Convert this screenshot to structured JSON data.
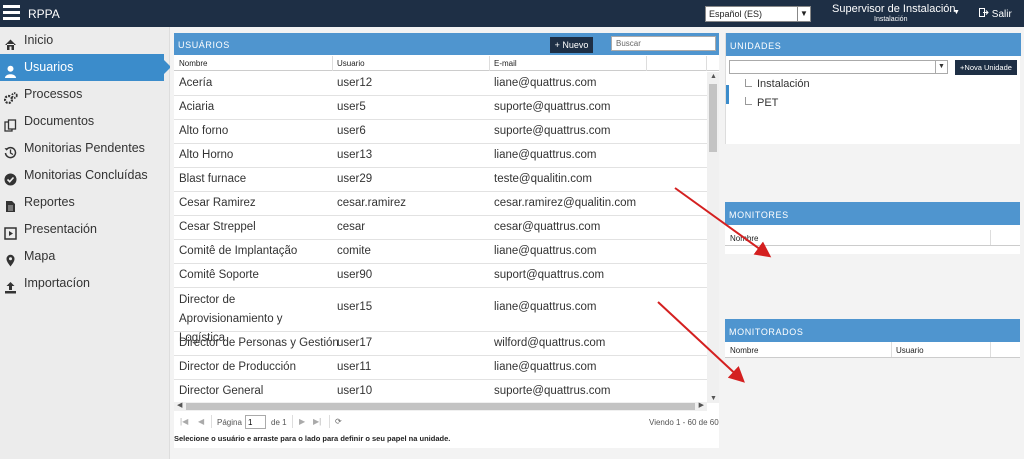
{
  "app": {
    "title": "RPPA"
  },
  "topbar": {
    "language": "Español (ES)",
    "user_name": "Supervisor de Instalación",
    "user_role": "Instalación",
    "logout_label": "Salir"
  },
  "sidebar": {
    "items": [
      {
        "label": "Inicio",
        "icon": "home-icon",
        "active": false
      },
      {
        "label": "Usuarios",
        "icon": "user-icon",
        "active": true
      },
      {
        "label": "Processos",
        "icon": "gears-icon",
        "active": false
      },
      {
        "label": "Documentos",
        "icon": "documents-icon",
        "active": false
      },
      {
        "label": "Monitorias Pendentes",
        "icon": "history-icon",
        "active": false
      },
      {
        "label": "Monitorias Concluídas",
        "icon": "check-circle-icon",
        "active": false
      },
      {
        "label": "Reportes",
        "icon": "file-icon",
        "active": false
      },
      {
        "label": "Presentación",
        "icon": "play-square-icon",
        "active": false
      },
      {
        "label": "Mapa",
        "icon": "map-marker-icon",
        "active": false
      },
      {
        "label": "Importacíon",
        "icon": "upload-icon",
        "active": false
      }
    ]
  },
  "users": {
    "title": "USUÁRIOS",
    "new_button": "+ Nuevo",
    "search_placeholder": "Buscar",
    "columns": [
      "Nombre",
      "Usuario",
      "E-mail"
    ],
    "rows": [
      {
        "nombre": "Acería",
        "usuario": "user12",
        "email": "liane@quattrus.com"
      },
      {
        "nombre": "Aciaria",
        "usuario": "user5",
        "email": "suporte@quattrus.com"
      },
      {
        "nombre": "Alto forno",
        "usuario": "user6",
        "email": "suporte@quattrus.com"
      },
      {
        "nombre": "Alto Horno",
        "usuario": "user13",
        "email": "liane@quattrus.com"
      },
      {
        "nombre": "Blast furnace",
        "usuario": "user29",
        "email": "teste@qualitin.com"
      },
      {
        "nombre": "Cesar Ramirez",
        "usuario": "cesar.ramirez",
        "email": "cesar.ramirez@qualitin.com"
      },
      {
        "nombre": "Cesar Streppel",
        "usuario": "cesar",
        "email": "cesar@quattrus.com"
      },
      {
        "nombre": "Comitê de Implantação",
        "usuario": "comite",
        "email": "liane@quattrus.com"
      },
      {
        "nombre": "Comitê Soporte",
        "usuario": "user90",
        "email": "suport@quattrus.com"
      },
      {
        "nombre": "Director de Aprovisionamiento y Logística",
        "usuario": "user15",
        "email": "liane@quattrus.com",
        "tall": true
      },
      {
        "nombre": "Director de Personas y Gestión",
        "usuario": "user17",
        "email": "wilford@quattrus.com"
      },
      {
        "nombre": "Director de Producción",
        "usuario": "user11",
        "email": "liane@quattrus.com"
      },
      {
        "nombre": "Director General",
        "usuario": "user10",
        "email": "suporte@quattrus.com"
      }
    ],
    "pager": {
      "page_label": "Página",
      "page_value": "1",
      "of_label": "de 1",
      "viewing": "Viendo 1 - 60 de 60"
    },
    "hint": "Selecione o usuário e arraste para o lado para definir o seu papel na unidade."
  },
  "unidades": {
    "title": "UNIDADES",
    "new_unit_button": "+Nova Unidade",
    "tree": [
      "Instalación",
      "PET"
    ]
  },
  "monitores": {
    "title": "MONITORES",
    "columns": [
      "Nombre"
    ]
  },
  "monitorados": {
    "title": "MONITORADOS",
    "columns": [
      "Nombre",
      "Usuario"
    ]
  },
  "colors": {
    "topbar": "#1e2f45",
    "accent": "#3b8ccb",
    "panel_header": "#4f95cf",
    "annotation_arrow": "#d42020"
  }
}
